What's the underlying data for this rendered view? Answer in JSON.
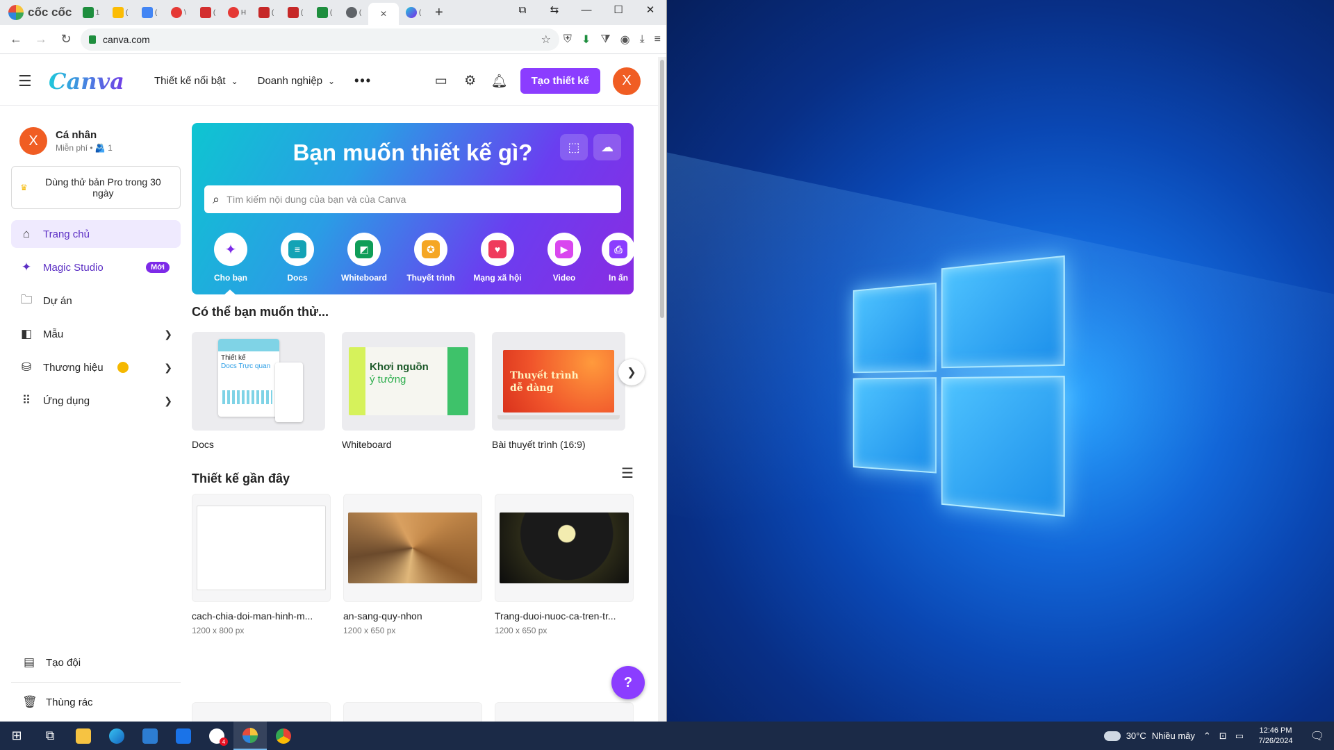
{
  "browser": {
    "brand": "cốc cốc",
    "tabs": [
      {
        "icon": "sheets-icon",
        "label": "1",
        "color": "#1e8e3e"
      },
      {
        "icon": "drive-icon",
        "label": "(",
        "color": "#fbbc04"
      },
      {
        "icon": "docs-icon",
        "label": "(",
        "color": "#4285f4"
      },
      {
        "icon": "media-icon",
        "label": "\\",
        "color": "#e53935"
      },
      {
        "icon": "s-icon",
        "label": "(",
        "color": "#d32f2f"
      },
      {
        "icon": "p-icon",
        "label": "H",
        "color": "#e53935"
      },
      {
        "icon": "nk-icon",
        "label": "(",
        "color": "#c62828"
      },
      {
        "icon": "dtv-icon",
        "label": "(",
        "color": "#c62828"
      },
      {
        "icon": "sheets-icon",
        "label": "(",
        "color": "#1e8e3e"
      },
      {
        "icon": "globe-icon",
        "label": "(",
        "color": "#5f6368"
      }
    ],
    "active_tab_close": "✕",
    "url": "canva.com"
  },
  "canva": {
    "nav": {
      "featured": "Thiết kế nổi bật",
      "business": "Doanh nghiệp",
      "create": "Tạo thiết kế",
      "avatar": "X"
    },
    "profile": {
      "initial": "X",
      "name": "Cá nhân",
      "plan": "Miễn phí • 🫂 1"
    },
    "trial": "Dùng thử bản Pro trong 30 ngày",
    "menu": {
      "home": "Trang chủ",
      "magic": "Magic Studio",
      "magic_badge": "Mới",
      "projects": "Dự án",
      "templates": "Mẫu",
      "brand": "Thương hiệu",
      "apps": "Ứng dụng",
      "team": "Tạo đội",
      "trash": "Thùng rác"
    },
    "hero": {
      "title": "Bạn muốn thiết kế gì?",
      "search_placeholder": "Tìm kiếm nội dung của bạn và của Canva",
      "categories": [
        {
          "label": "Cho bạn",
          "icon": "sparkle-icon",
          "color": "#7d2ae8"
        },
        {
          "label": "Docs",
          "icon": "docs-icon",
          "color": "#13a3b5"
        },
        {
          "label": "Whiteboard",
          "icon": "whiteboard-icon",
          "color": "#0f9d58"
        },
        {
          "label": "Thuyết trình",
          "icon": "presentation-icon",
          "color": "#f5a623"
        },
        {
          "label": "Mạng xã hội",
          "icon": "heart-icon",
          "color": "#ef3b5d"
        },
        {
          "label": "Video",
          "icon": "video-icon",
          "color": "#d946ef"
        },
        {
          "label": "In ấn",
          "icon": "print-icon",
          "color": "#8b3dff"
        }
      ]
    },
    "suggest": {
      "title": "Có thể bạn muốn thử...",
      "items": [
        {
          "label": "Docs",
          "art1": "Thiết kế",
          "art2": "Docs Trực quan"
        },
        {
          "label": "Whiteboard",
          "art1": "Khơi nguồn",
          "art2": "ý tưởng"
        },
        {
          "label": "Bài thuyết trình (16:9)",
          "art1": "Thuyết trình",
          "art2": "dễ dàng"
        }
      ]
    },
    "recent": {
      "title": "Thiết kế gần đây",
      "items": [
        {
          "title": "cach-chia-doi-man-hinh-m...",
          "size": "1200 x 800 px"
        },
        {
          "title": "an-sang-quy-nhon",
          "size": "1200 x 650 px"
        },
        {
          "title": "Trang-duoi-nuoc-ca-tren-tr...",
          "size": "1200 x 650 px"
        }
      ]
    },
    "help": "?"
  },
  "taskbar": {
    "temperature": "30°C",
    "weather": "Nhiều mây",
    "time": "12:46 PM",
    "date": "7/26/2024",
    "mail_badge": "4"
  }
}
